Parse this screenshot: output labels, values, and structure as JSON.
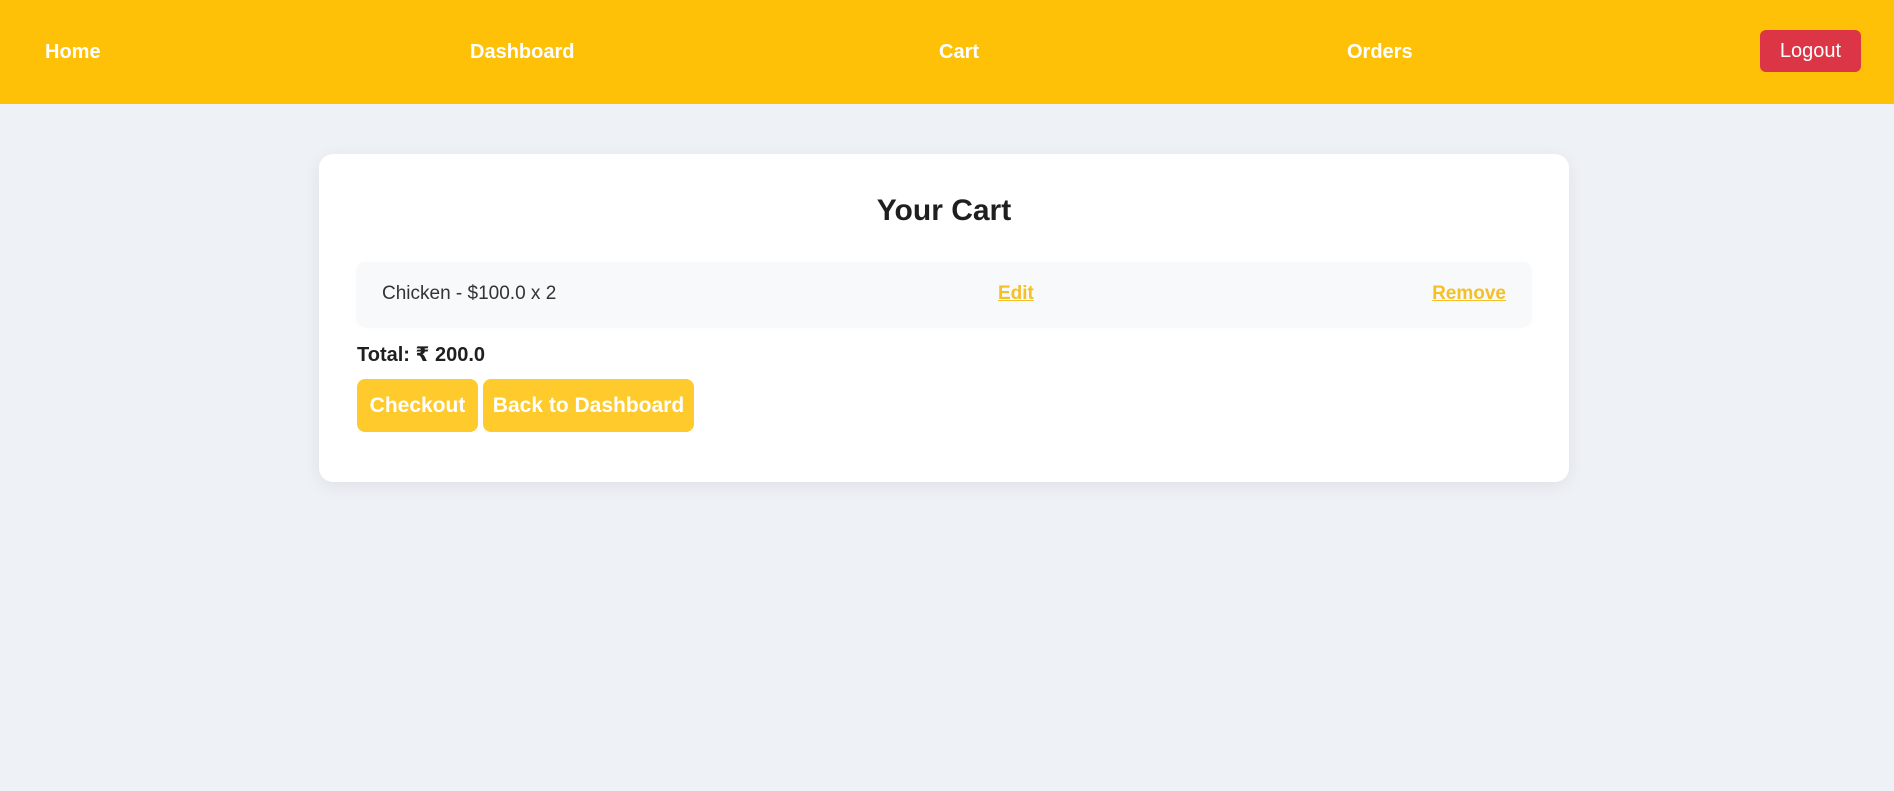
{
  "nav": {
    "home": "Home",
    "dashboard": "Dashboard",
    "cart": "Cart",
    "orders": "Orders",
    "logout": "Logout"
  },
  "cart": {
    "title": "Your Cart",
    "items": [
      {
        "label": "Chicken - $100.0 x 2",
        "edit": "Edit",
        "remove": "Remove"
      }
    ],
    "total": "Total: ₹ 200.0",
    "checkout_label": "Checkout",
    "back_label": "Back to Dashboard"
  },
  "colors": {
    "nav_bg": "#ffc107",
    "logout_bg": "#dc3545",
    "button_bg": "#ffca2c",
    "link": "#f5c026",
    "page_bg": "#eef2f7"
  }
}
